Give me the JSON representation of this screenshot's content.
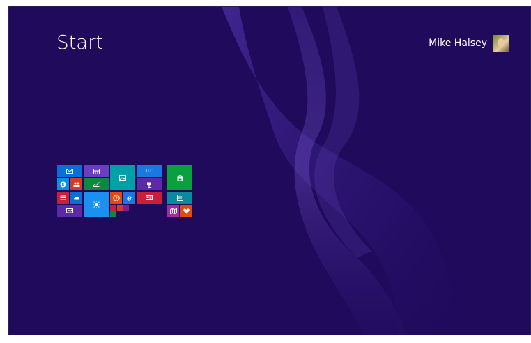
{
  "screen": {
    "title": "Start",
    "user_name": "Mike Halsey",
    "avatar_icon": "user-photo",
    "background_color": "#1f0a5c"
  },
  "tiles": [
    {
      "name": "mail-tile",
      "icon": "mail-icon",
      "color": "#0a6fd6"
    },
    {
      "name": "calendar-tile",
      "icon": "calendar-icon",
      "color": "#6a3ec0"
    },
    {
      "name": "photos-tile",
      "icon": "photos-icon",
      "color": "#00a0a8"
    },
    {
      "name": "tlc-tile",
      "icon": "tlc-logo",
      "label": "TLC",
      "color": "#1a78e0"
    },
    {
      "name": "skype-tile",
      "icon": "skype-icon",
      "color": "#0a8ee6"
    },
    {
      "name": "people-tile",
      "icon": "people-icon",
      "color": "#d23a2a"
    },
    {
      "name": "finance-tile",
      "icon": "finance-icon",
      "color": "#0a8a3a"
    },
    {
      "name": "sport-tile",
      "icon": "trophy-icon",
      "color": "#5a2aa8"
    },
    {
      "name": "reading-list-tile",
      "icon": "reading-list-icon",
      "color": "#c8203a"
    },
    {
      "name": "onedrive-tile",
      "icon": "cloud-icon",
      "color": "#0a6fd6"
    },
    {
      "name": "weather-tile",
      "icon": "sun-icon",
      "color": "#1a90f0"
    },
    {
      "name": "help-tips-tile",
      "icon": "help-icon",
      "color": "#e24a12"
    },
    {
      "name": "internet-explorer-tile",
      "icon": "ie-icon",
      "color": "#1a78e0"
    },
    {
      "name": "news-tile",
      "icon": "news-icon",
      "color": "#c8203a"
    },
    {
      "name": "desktop-tile",
      "icon": "desktop-icon",
      "color": "#5a2aa8"
    },
    {
      "name": "small-tile-1",
      "icon": "",
      "color": "#c8203a"
    },
    {
      "name": "small-tile-2",
      "icon": "",
      "color": "#d23a2a"
    },
    {
      "name": "small-tile-3",
      "icon": "",
      "color": "#8a1a8a"
    },
    {
      "name": "small-tile-4",
      "icon": "",
      "color": "#0a8a3a"
    },
    {
      "name": "store-tile",
      "icon": "store-icon",
      "color": "#0aa040"
    },
    {
      "name": "food-drink-tile",
      "icon": "food-icon",
      "color": "#0a8a9a"
    },
    {
      "name": "maps-tile",
      "icon": "maps-icon",
      "color": "#a02aa8"
    },
    {
      "name": "health-fitness-tile",
      "icon": "heart-icon",
      "color": "#e24a12"
    }
  ]
}
